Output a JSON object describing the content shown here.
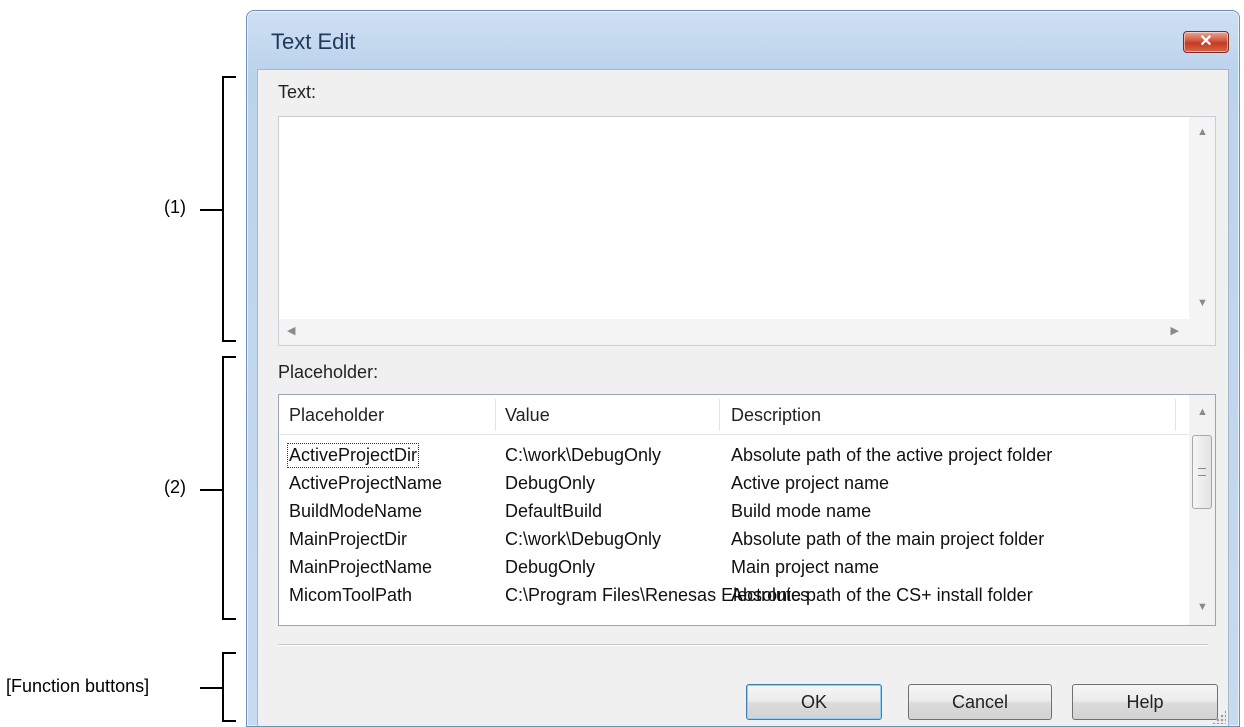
{
  "annotations": {
    "callout_1": "(1)",
    "callout_2": "(2)",
    "callout_function": "[Function buttons]"
  },
  "dialog": {
    "title": "Text Edit",
    "close_glyph": "✕",
    "text_label": "Text:",
    "text_value": "",
    "placeholder_label": "Placeholder:",
    "columns": [
      "Placeholder",
      "Value",
      "Description"
    ],
    "rows": [
      {
        "placeholder": "ActiveProjectDir",
        "value": "C:\\work\\DebugOnly",
        "description": "Absolute path of the active project folder"
      },
      {
        "placeholder": "ActiveProjectName",
        "value": "DebugOnly",
        "description": "Active project name"
      },
      {
        "placeholder": "BuildModeName",
        "value": "DefaultBuild",
        "description": "Build mode name"
      },
      {
        "placeholder": "MainProjectDir",
        "value": "C:\\work\\DebugOnly",
        "description": "Absolute path of the main project folder"
      },
      {
        "placeholder": "MainProjectName",
        "value": "DebugOnly",
        "description": "Main project name"
      },
      {
        "placeholder": "MicomToolPath",
        "value": "C:\\Program Files\\Renesas Electronics",
        "description": "Absolute path of the CS+ install folder"
      }
    ],
    "buttons": {
      "ok": "OK",
      "cancel": "Cancel",
      "help": "Help"
    }
  }
}
